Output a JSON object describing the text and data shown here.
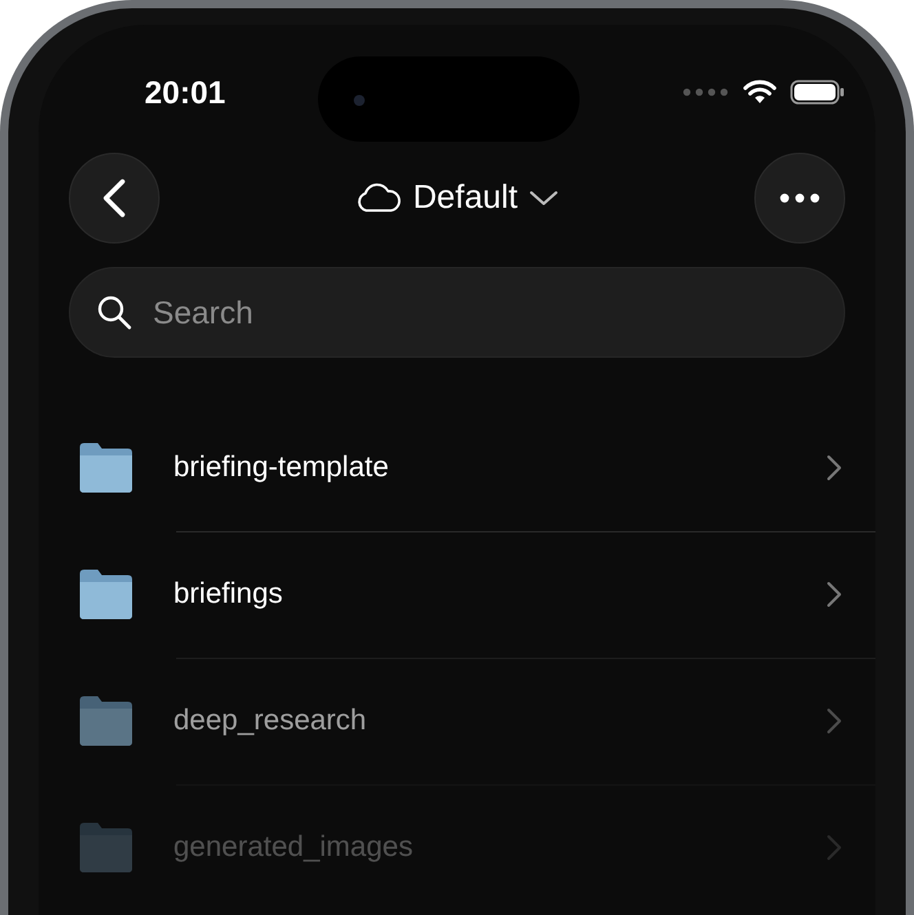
{
  "status_bar": {
    "time": "20:01"
  },
  "nav": {
    "title": "Default"
  },
  "search": {
    "placeholder": "Search"
  },
  "folders": [
    {
      "name": "briefing-template"
    },
    {
      "name": "briefings"
    },
    {
      "name": "deep_research"
    },
    {
      "name": "generated_images"
    }
  ]
}
